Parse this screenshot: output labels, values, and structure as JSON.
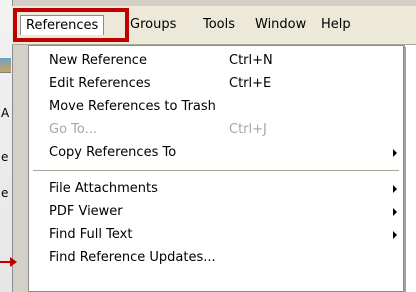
{
  "menubar": {
    "items": [
      {
        "label": "References"
      },
      {
        "label": "Groups"
      },
      {
        "label": "Tools"
      },
      {
        "label": "Window"
      },
      {
        "label": "Help"
      }
    ]
  },
  "dropdown": {
    "items": [
      {
        "label": "New Reference",
        "shortcut": "Ctrl+N"
      },
      {
        "label": "Edit References",
        "shortcut": "Ctrl+E"
      },
      {
        "label": "Move References to Trash",
        "shortcut": ""
      },
      {
        "label": "Go To...",
        "shortcut": "Ctrl+J",
        "disabled": true
      },
      {
        "label": "Copy References To",
        "submenu": true
      },
      {
        "label": "File Attachments",
        "submenu": true
      },
      {
        "label": "PDF Viewer",
        "submenu": true
      },
      {
        "label": "Find Full Text",
        "submenu": true
      },
      {
        "label": "Find Reference Updates..."
      }
    ]
  },
  "background": {
    "glyphs": [
      "A",
      "e",
      "e"
    ]
  },
  "colors": {
    "highlight_box": "#c00000",
    "menu_bg": "#ffffff",
    "menubar_bg": "#ece9d8",
    "disabled_text": "#a7a79f"
  },
  "icons": {
    "submenu": "submenu-arrow-icon",
    "pointer": "red-pointer-arrow-icon"
  }
}
